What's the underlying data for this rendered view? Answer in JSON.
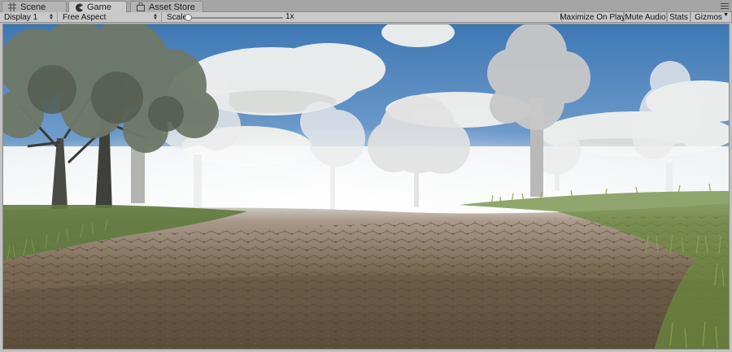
{
  "tabs": {
    "scene": {
      "label": "Scene",
      "icon": "grid-icon"
    },
    "game": {
      "label": "Game",
      "icon": "pacman-icon"
    },
    "asset_store": {
      "label": "Asset Store",
      "icon": "shopping-bag-icon"
    }
  },
  "toolbar": {
    "display": "Display 1",
    "aspect": "Free Aspect",
    "scale_label": "Scale",
    "scale_value": "1x",
    "scale_fraction": 0.0,
    "maximize_on_play": "Maximize On Play",
    "mute_audio": "Mute Audio",
    "stats": "Stats",
    "gizmos": "Gizmos"
  },
  "scene": {
    "description_icon": "forest-scene",
    "colors": {
      "sky_top": "#3f7fbf",
      "fog": "#f4f6f6",
      "ground": "#7a6a55",
      "grass": "#5f7a3a"
    }
  }
}
